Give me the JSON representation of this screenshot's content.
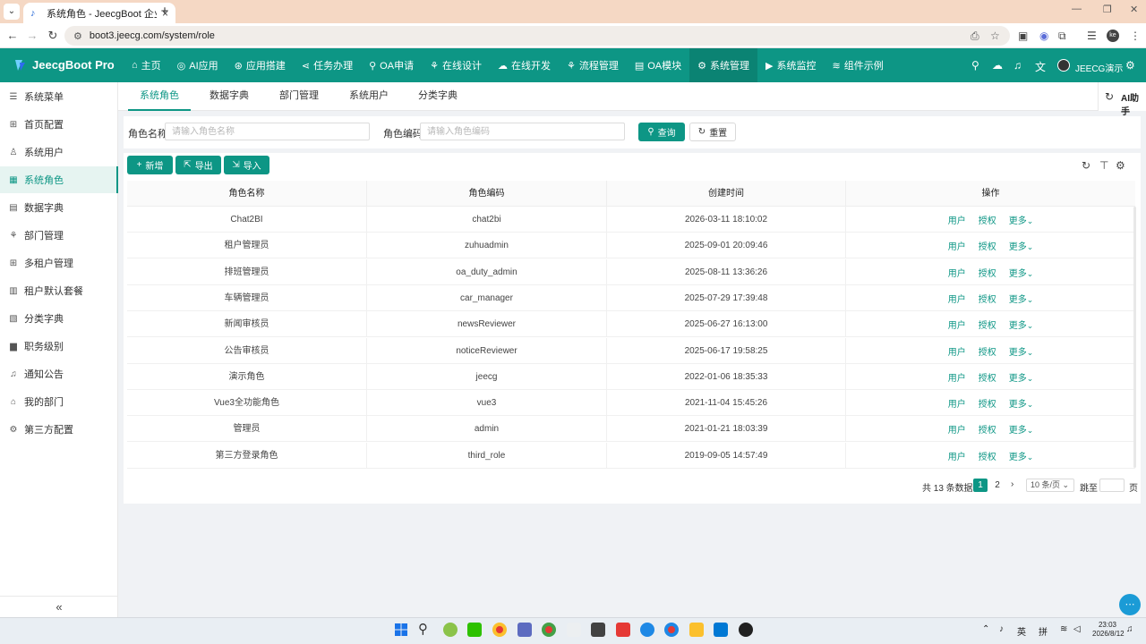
{
  "browser": {
    "tab_title": "系统角色 - JeecgBoot 企业级低",
    "url": "boot3.jeecg.com/system/role",
    "profile_initials": "ke"
  },
  "app": {
    "brand": "JeecgBoot Pro",
    "accent_color": "#0d9685",
    "user_name": "JEECG演示",
    "top_nav": [
      {
        "label": "主页",
        "icon": "home-icon"
      },
      {
        "label": "AI应用",
        "icon": "ai-icon"
      },
      {
        "label": "应用搭建",
        "icon": "build-icon"
      },
      {
        "label": "任务办理",
        "icon": "task-icon"
      },
      {
        "label": "OA申请",
        "icon": "oa-icon"
      },
      {
        "label": "在线设计",
        "icon": "design-icon"
      },
      {
        "label": "在线开发",
        "icon": "cloud-icon"
      },
      {
        "label": "流程管理",
        "icon": "flow-icon"
      },
      {
        "label": "OA模块",
        "icon": "module-icon"
      },
      {
        "label": "系统管理",
        "icon": "gear-icon"
      },
      {
        "label": "系统监控",
        "icon": "monitor-icon"
      },
      {
        "label": "组件示例",
        "icon": "layers-icon"
      }
    ]
  },
  "sidebar": {
    "items": [
      {
        "label": "系统菜单",
        "icon": "menu-icon"
      },
      {
        "label": "首页配置",
        "icon": "grid-icon"
      },
      {
        "label": "系统用户",
        "icon": "user-icon"
      },
      {
        "label": "系统角色",
        "icon": "role-icon"
      },
      {
        "label": "数据字典",
        "icon": "dict-icon"
      },
      {
        "label": "部门管理",
        "icon": "dept-icon"
      },
      {
        "label": "多租户管理",
        "icon": "tenant-icon"
      },
      {
        "label": "租户默认套餐",
        "icon": "package-icon"
      },
      {
        "label": "分类字典",
        "icon": "category-icon"
      },
      {
        "label": "职务级别",
        "icon": "position-icon"
      },
      {
        "label": "通知公告",
        "icon": "bell-icon"
      },
      {
        "label": "我的部门",
        "icon": "home-icon"
      },
      {
        "label": "第三方配置",
        "icon": "gear-icon"
      }
    ],
    "collapse_label": "«"
  },
  "subtabs": [
    "系统角色",
    "数据字典",
    "部门管理",
    "系统用户",
    "分类字典"
  ],
  "ai_help": "AI助手",
  "search": {
    "role_name_label": "角色名称:",
    "role_name_placeholder": "请输入角色名称",
    "role_code_label": "角色编码:",
    "role_code_placeholder": "请输入角色编码",
    "query_label": "查询",
    "reset_label": "重置"
  },
  "toolbar": {
    "add_label": "新增",
    "export_label": "导出",
    "import_label": "导入"
  },
  "table": {
    "columns": [
      "角色名称",
      "角色编码",
      "创建时间",
      "操作"
    ],
    "op_user": "用户",
    "op_auth": "授权",
    "op_more": "更多",
    "rows": [
      {
        "name": "Chat2BI",
        "code": "chat2bi",
        "time": "2026-03-11 18:10:02"
      },
      {
        "name": "租户管理员",
        "code": "zuhuadmin",
        "time": "2025-09-01 20:09:46"
      },
      {
        "name": "排班管理员",
        "code": "oa_duty_admin",
        "time": "2025-08-11 13:36:26"
      },
      {
        "name": "车辆管理员",
        "code": "car_manager",
        "time": "2025-07-29 17:39:48"
      },
      {
        "name": "新闻审核员",
        "code": "newsReviewer",
        "time": "2025-06-27 16:13:00"
      },
      {
        "name": "公告审核员",
        "code": "noticeReviewer",
        "time": "2025-06-17 19:58:25"
      },
      {
        "name": "演示角色",
        "code": "jeecg",
        "time": "2022-01-06 18:35:33"
      },
      {
        "name": "Vue3全功能角色",
        "code": "vue3",
        "time": "2021-11-04 15:45:26"
      },
      {
        "name": "管理员",
        "code": "admin",
        "time": "2021-01-21 18:03:39"
      },
      {
        "name": "第三方登录角色",
        "code": "third_role",
        "time": "2019-09-05 14:57:49"
      }
    ]
  },
  "pagination": {
    "total": "共 13 条数据",
    "pages": [
      "1",
      "2"
    ],
    "page_size": "10 条/页",
    "goto_label": "跳至",
    "page_label": "页"
  },
  "taskbar": {
    "lang": "英",
    "ime": "拼",
    "time": "23:03",
    "date": "2026/8/12"
  }
}
